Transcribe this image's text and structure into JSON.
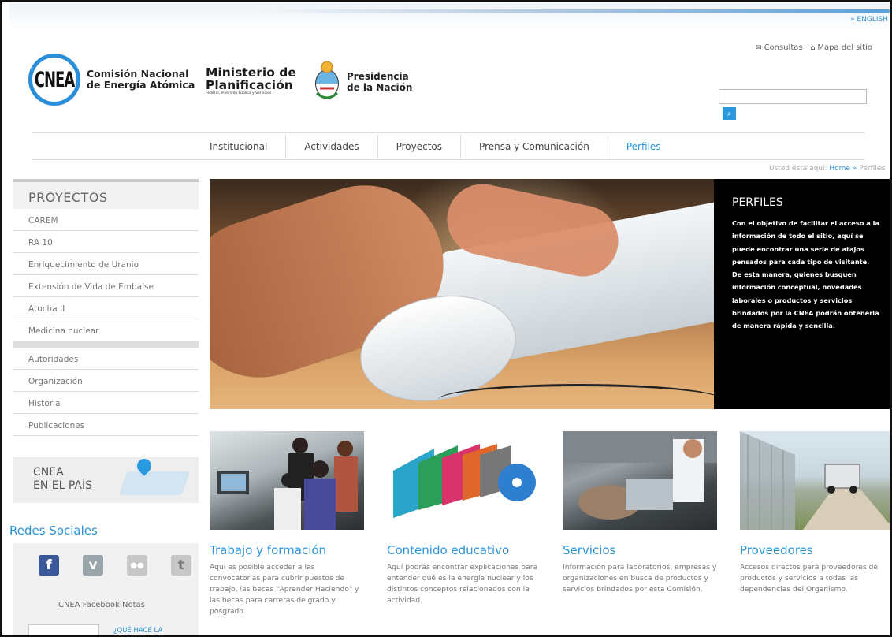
{
  "header": {
    "language_link": "» ENGLISH",
    "top_links": [
      {
        "icon": "envelope-icon",
        "label": "Consultas"
      },
      {
        "icon": "sitemap-icon",
        "label": "Mapa del sitio"
      }
    ],
    "logo_cnea": {
      "mark": "CNEA",
      "line1": "Comisión Nacional",
      "line2": "de Energía Atómica"
    },
    "logo_ministerio": {
      "line1": "Ministerio de",
      "line2": "Planificación",
      "sub": "Federal, Inversión Pública y Servicios"
    },
    "logo_presidencia": {
      "line1": "Presidencia",
      "line2": "de la Nación"
    },
    "search": {
      "placeholder": "",
      "button_icon": "search-icon"
    }
  },
  "nav": {
    "items": [
      "Institucional",
      "Actividades",
      "Proyectos",
      "Prensa y Comunicación",
      "Perfiles"
    ],
    "active": "Perfiles"
  },
  "breadcrumb": {
    "prefix": "Usted está aquí:",
    "home": "Home",
    "separator": "»",
    "current": "Perfiles"
  },
  "sidebar": {
    "heading": "PROYECTOS",
    "projects": [
      "CAREM",
      "RA 10",
      "Enriquecimiento de Uranio",
      "Extensión de Vida de Embalse",
      "Atucha II",
      "Medicina nuclear"
    ],
    "institution": [
      "Autoridades",
      "Organización",
      "Historia",
      "Publicaciones"
    ],
    "map_banner": {
      "line1": "CNEA",
      "line2": "EN EL PAÍS"
    },
    "social": {
      "title": "Redes Sociales",
      "icons": [
        "facebook-icon",
        "vimeo-icon",
        "flickr-icon",
        "twitter-icon"
      ],
      "facebook_notes": "CNEA Facebook Notas",
      "note_link": "¿QUÉ HACE LA"
    }
  },
  "perfiles": {
    "title": "PERFILES",
    "text": "Con el objetivo de facilitar el acceso a la información de todo el sitio, aquí se puede encontrar una serie de atajos pensados para cada tipo de visitante. De esta manera, quienes busquen información conceptual, novedades laborales o productos y servicios brindados por la CNEA podrán obtenerla de manera rápida y sencilla."
  },
  "cards": [
    {
      "title": "Trabajo y formación",
      "text": "Aquí es posible acceder a las convocatorias para cubrir puestos de trabajo, las becas \"Aprender Haciendo\" y las becas para carreras de grado y posgrado."
    },
    {
      "title": "Contenido educativo",
      "text": "Aquí podrás encontrar explicaciones para entender qué es la energía nuclear y los distintos conceptos relacionados con la actividad."
    },
    {
      "title": "Servicios",
      "text": "Información para laboratorios, empresas y organizaciones en busca de productos y servicios brindados por esta Comisión."
    },
    {
      "title": "Proveedores",
      "text": "Accesos directos para proveedores de productos y servicios a todas las dependencias del Organismo."
    }
  ],
  "colors": {
    "accent": "#2a93d5",
    "dark": "#000000",
    "facebook": "#3b5998"
  }
}
